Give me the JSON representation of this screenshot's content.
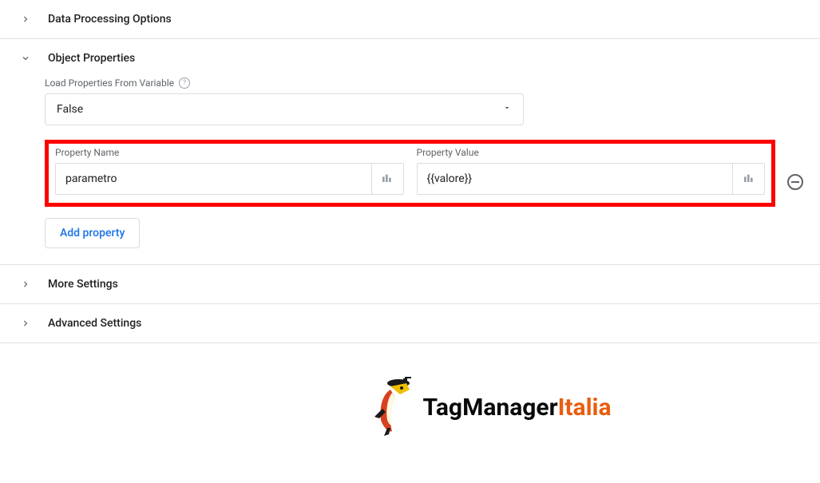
{
  "sections": {
    "data_processing": {
      "title": "Data Processing Options"
    },
    "object_properties": {
      "title": "Object Properties",
      "load_label": "Load Properties From Variable",
      "load_value": "False",
      "property_name_label": "Property Name",
      "property_name_value": "parametro",
      "property_value_label": "Property Value",
      "property_value_value": "{{valore}}",
      "add_button": "Add property"
    },
    "more_settings": {
      "title": "More Settings"
    },
    "advanced_settings": {
      "title": "Advanced Settings"
    }
  },
  "logo": {
    "brand_a": "TagManager",
    "brand_b": "Italia"
  }
}
